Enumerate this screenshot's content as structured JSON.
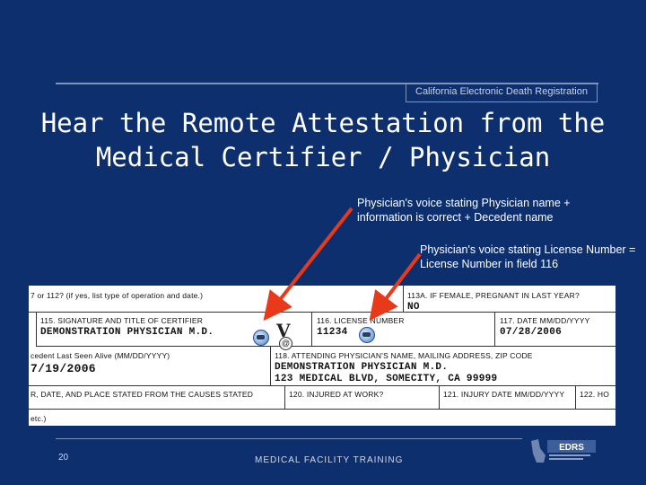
{
  "header": {
    "brand": "California Electronic Death Registration"
  },
  "slide": {
    "title_line1": "Hear the Remote Attestation from the",
    "title_line2": "Medical Certifier / Physician",
    "note1": "Physician's voice stating Physician name + information is correct + Decedent name",
    "note2": "Physician's voice stating License Number = License Number in field 116",
    "arrow_color": "#e8391a"
  },
  "form": {
    "row1_left_label": "7 or 112? (if yes, list type of operation and date.)",
    "row1_right_label": "113A. IF FEMALE, PREGNANT IN LAST YEAR?",
    "row1_right_value": "NO",
    "f115_label": "115. SIGNATURE AND TITLE OF CERTIFIER",
    "f115_value": "DEMONSTRATION PHYSICIAN M.D.",
    "f116_label": "116. LICENSE NUMBER",
    "f116_value": "11234",
    "f117_label": "117. DATE MM/DD/YYYY",
    "f117_value": "07/28/2006",
    "last_seen_label": "cedent Last Seen Alive (MM/DD/YYYY)",
    "last_seen_value": "7/19/2006",
    "f118_label": "118. ATTENDING PHYSICIAN'S NAME, MAILING ADDRESS, ZIP CODE",
    "f118_value1": "DEMONSTRATION PHYSICIAN M.D.",
    "f118_value2": "123 MEDICAL BLVD, SOMECITY, CA 99999",
    "row4_left_label": "R, DATE, AND PLACE STATED FROM THE CAUSES STATED",
    "f120_label": "120. INJURED AT WORK?",
    "f121_label": "121. INJURY DATE MM/DD/YYYY",
    "f122_label": "122. HO",
    "row5_left_label": "etc.)"
  },
  "footer": {
    "page_number": "20",
    "text": "MEDICAL FACILITY TRAINING",
    "logo_text": "EDRS"
  }
}
